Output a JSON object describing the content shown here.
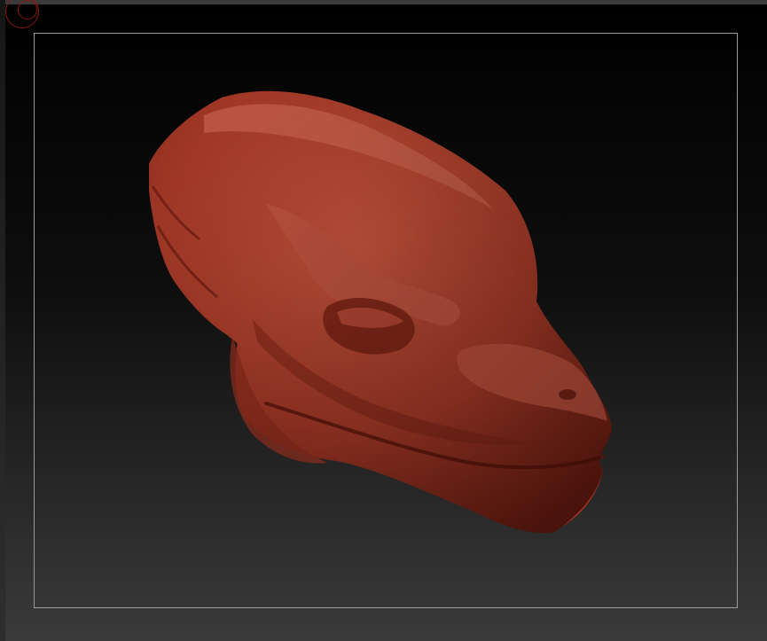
{
  "viewport": {
    "background_top": "#000000",
    "background_bottom": "#3a3a3a",
    "frame_color": "#9a9a9a"
  },
  "indicator": {
    "icon": "record-circle-icon",
    "color": "#8a1a12"
  },
  "model": {
    "icon": "sculpted-creature-head",
    "material_color": "#b0412f",
    "highlight_color": "#d06a55",
    "shadow_color": "#6a1a10"
  }
}
